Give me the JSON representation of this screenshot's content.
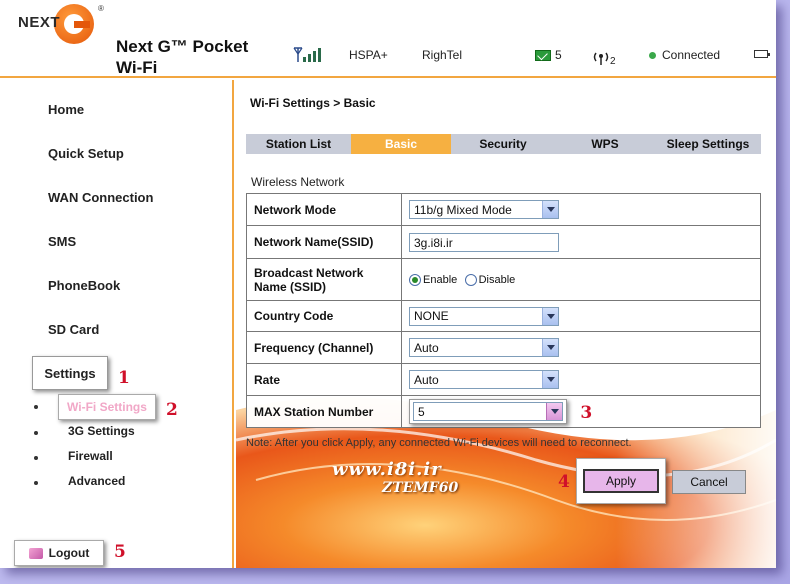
{
  "header": {
    "logo_text": "NEXT",
    "logo_reg": "®",
    "product_title": "Next G™ Pocket Wi-Fi",
    "signal_icon": "signal-bars-icon",
    "network_type": "HSPA+",
    "carrier": "RighTel",
    "sms_count": "5",
    "wifi_clients": "2",
    "connection_status": "Connected"
  },
  "sidebar": {
    "items": [
      {
        "label": "Home"
      },
      {
        "label": "Quick Setup"
      },
      {
        "label": "WAN Connection"
      },
      {
        "label": "SMS"
      },
      {
        "label": "PhoneBook"
      },
      {
        "label": "SD Card"
      }
    ],
    "settings_label": "Settings",
    "sub_items": [
      {
        "label": "Wi-Fi Settings"
      },
      {
        "label": "3G Settings"
      },
      {
        "label": "Firewall"
      },
      {
        "label": "Advanced"
      }
    ],
    "logout_label": "Logout"
  },
  "annotations": {
    "a1": "1",
    "a2": "2",
    "a3": "3",
    "a4": "4",
    "a5": "5"
  },
  "main": {
    "breadcrumb": "Wi-Fi Settings > Basic",
    "tabs": [
      {
        "label": "Station List"
      },
      {
        "label": "Basic"
      },
      {
        "label": "Security"
      },
      {
        "label": "WPS"
      },
      {
        "label": "Sleep Settings"
      }
    ],
    "section_title": "Wireless Network",
    "fields": {
      "network_mode": {
        "label": "Network Mode",
        "value": "11b/g Mixed Mode"
      },
      "ssid": {
        "label": "Network Name(SSID)",
        "value": "3g.i8i.ir"
      },
      "broadcast": {
        "label": "Broadcast Network Name (SSID)",
        "enable": "Enable",
        "disable": "Disable"
      },
      "country": {
        "label": "Country Code",
        "value": "NONE"
      },
      "frequency": {
        "label": "Frequency (Channel)",
        "value": "Auto"
      },
      "rate": {
        "label": "Rate",
        "value": "Auto"
      },
      "max_station": {
        "label": "MAX Station Number",
        "value": "5"
      }
    },
    "note": "Note: After you click Apply, any connected Wi-Fi devices will need to reconnect.",
    "watermark_url": "www.i8i.ir",
    "watermark_model": "ZTEMF60",
    "apply_label": "Apply",
    "cancel_label": "Cancel"
  },
  "colors": {
    "accent_orange": "#f6b041",
    "tab_bg": "#c8ccd8",
    "annotation_red": "#d0102a",
    "apply_bg": "#e7b6ea"
  }
}
